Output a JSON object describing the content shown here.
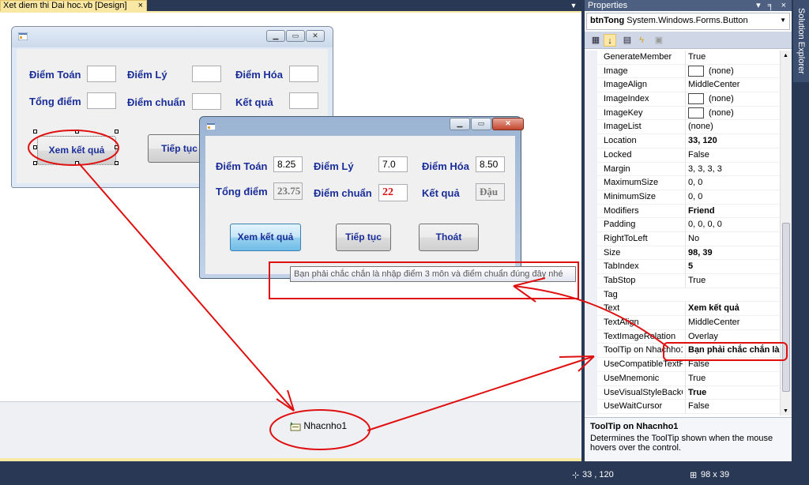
{
  "document": {
    "tab_title": "Xet diem thi Dai hoc.vb [Design]",
    "close_glyph": "×",
    "dropdown_glyph": "▼"
  },
  "design_form": {
    "labels": {
      "diem_toan": "Điểm Toán",
      "diem_ly": "Điểm Lý",
      "diem_hoa": "Điểm Hóa",
      "tong_diem": "Tổng điểm",
      "diem_chuan": "Điểm chuẩn",
      "ket_qua": "Kết quả"
    },
    "buttons": {
      "xem": "Xem kết quả",
      "tiep_tuc": "Tiếp tục"
    }
  },
  "run_form": {
    "labels": {
      "diem_toan": "Điểm Toán",
      "diem_ly": "Điểm Lý",
      "diem_hoa": "Điểm Hóa",
      "tong_diem": "Tổng điểm",
      "diem_chuan": "Điểm chuẩn",
      "ket_qua": "Kết quả"
    },
    "values": {
      "diem_toan": "8.25",
      "diem_ly": "7.0",
      "diem_hoa": "8.50",
      "tong_diem": "23.75",
      "diem_chuan": "22",
      "ket_qua": "Đậu"
    },
    "buttons": {
      "xem": "Xem kết quả",
      "tiep_tuc": "Tiếp tục",
      "thoat": "Thoát"
    }
  },
  "tooltip_text": "Bạn phải chắc chắn là nhập điểm 3 môn và điểm chuẩn đúng đây nhé",
  "tray_component": "Nhacnho1",
  "properties": {
    "title": "Properties",
    "title_tools": "▾ ╕ ×",
    "object_name": "btnTong",
    "object_type": "System.Windows.Forms.Button",
    "rows": [
      {
        "name": "GenerateMember",
        "value": "True"
      },
      {
        "name": "Image",
        "value": "(none)"
      },
      {
        "name": "ImageAlign",
        "value": "MiddleCenter"
      },
      {
        "name": "ImageIndex",
        "value": "(none)"
      },
      {
        "name": "ImageKey",
        "value": "(none)"
      },
      {
        "name": "ImageList",
        "value": "(none)"
      },
      {
        "name": "Location",
        "value": "33, 120"
      },
      {
        "name": "Locked",
        "value": "False"
      },
      {
        "name": "Margin",
        "value": "3, 3, 3, 3"
      },
      {
        "name": "MaximumSize",
        "value": "0, 0"
      },
      {
        "name": "MinimumSize",
        "value": "0, 0"
      },
      {
        "name": "Modifiers",
        "value": "Friend"
      },
      {
        "name": "Padding",
        "value": "0, 0, 0, 0"
      },
      {
        "name": "RightToLeft",
        "value": "No"
      },
      {
        "name": "Size",
        "value": "98, 39"
      },
      {
        "name": "TabIndex",
        "value": "5"
      },
      {
        "name": "TabStop",
        "value": "True"
      },
      {
        "name": "Tag",
        "value": ""
      },
      {
        "name": "Text",
        "value": "Xem kết quả"
      },
      {
        "name": "TextAlign",
        "value": "MiddleCenter"
      },
      {
        "name": "TextImageRelation",
        "value": "Overlay"
      },
      {
        "name": "ToolTip on Nhacnho1",
        "value": "Bạn phải chắc chắn là r"
      },
      {
        "name": "UseCompatibleTextRendering",
        "value": "False"
      },
      {
        "name": "UseMnemonic",
        "value": "True"
      },
      {
        "name": "UseVisualStyleBackColor",
        "value": "True"
      },
      {
        "name": "UseWaitCursor",
        "value": "False"
      }
    ],
    "description_title": "ToolTip on Nhacnho1",
    "description_text": "Determines the ToolTip shown when the mouse hovers over the control."
  },
  "solution_explorer_tab": "Solution Explorer",
  "status": {
    "location": "33 , 120",
    "size": "98 x 39"
  }
}
